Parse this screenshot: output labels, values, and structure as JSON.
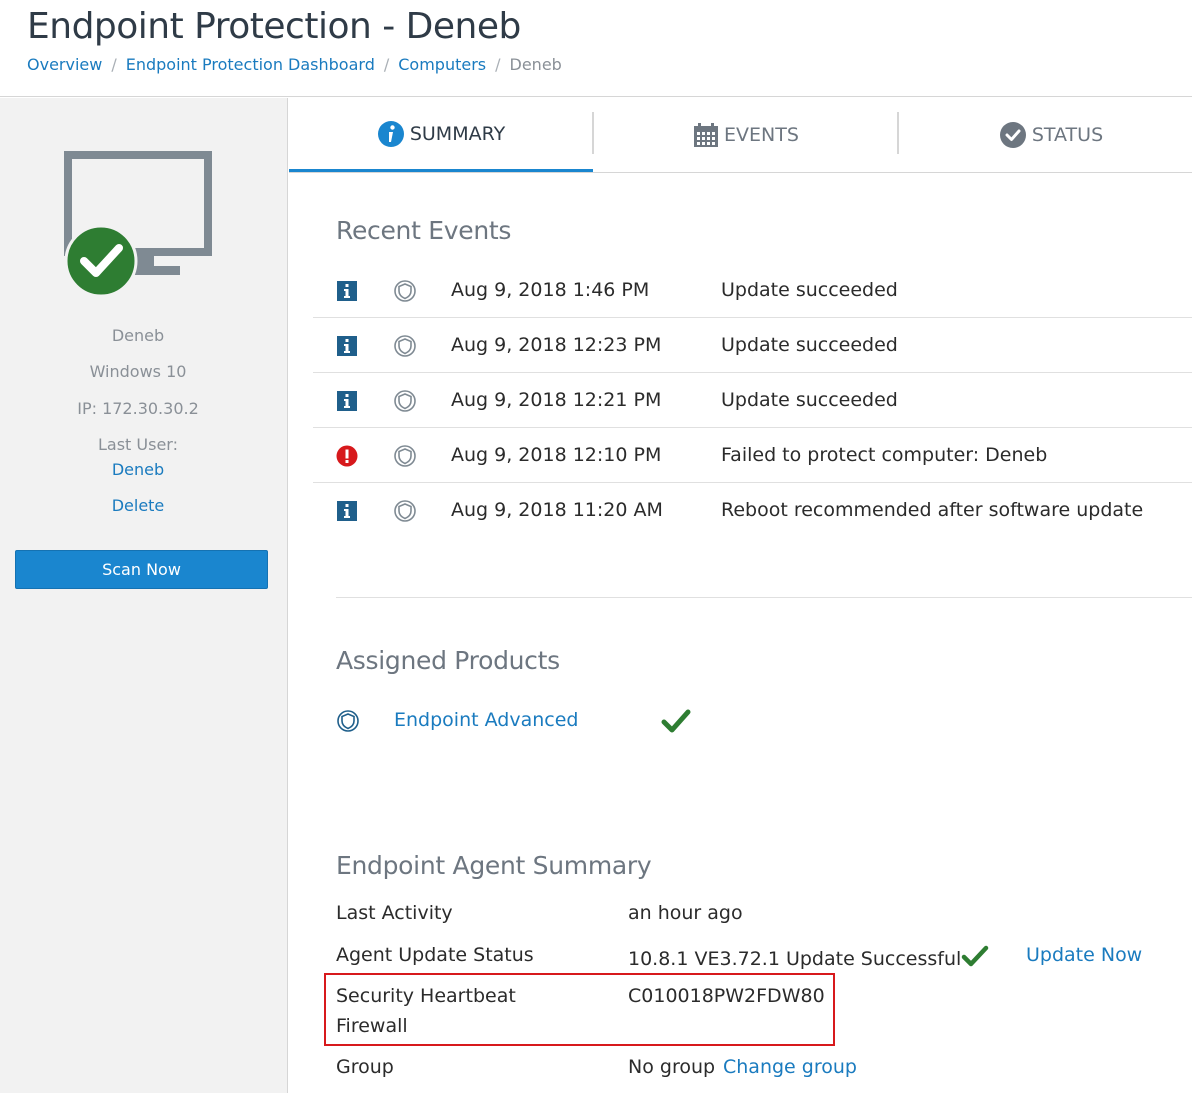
{
  "header": {
    "title": "Endpoint Protection - Deneb",
    "breadcrumb": [
      {
        "label": "Overview"
      },
      {
        "label": "Endpoint Protection Dashboard"
      },
      {
        "label": "Computers"
      },
      {
        "label": "Deneb"
      }
    ],
    "separator": "/"
  },
  "sidebar": {
    "device_icon": "monitor-icon",
    "status_icon": "check-circle-icon",
    "status_color": "#2e7d32",
    "computer_name": "Deneb",
    "os": "Windows 10",
    "ip": "IP: 172.30.30.2",
    "last_user_label": "Last User:",
    "last_user": "Deneb",
    "delete_label": "Delete",
    "scan_button": "Scan Now"
  },
  "tabs": [
    {
      "label": "SUMMARY",
      "icon": "info-circle-icon",
      "active": true
    },
    {
      "label": "EVENTS",
      "icon": "calendar-icon",
      "active": false
    },
    {
      "label": "STATUS",
      "icon": "check-circle-icon",
      "active": false
    }
  ],
  "recent_events": {
    "title": "Recent Events",
    "rows": [
      {
        "severity": "info",
        "icon": "info-icon",
        "product_icon": "shield-icon",
        "date": "Aug 9, 2018 1:46 PM",
        "description": "Update succeeded"
      },
      {
        "severity": "info",
        "icon": "info-icon",
        "product_icon": "shield-icon",
        "date": "Aug 9, 2018 12:23 PM",
        "description": "Update succeeded"
      },
      {
        "severity": "info",
        "icon": "info-icon",
        "product_icon": "shield-icon",
        "date": "Aug 9, 2018 12:21 PM",
        "description": "Update succeeded"
      },
      {
        "severity": "error",
        "icon": "error-icon",
        "product_icon": "shield-icon",
        "date": "Aug 9, 2018 12:10 PM",
        "description": "Failed to protect computer: Deneb"
      },
      {
        "severity": "info",
        "icon": "info-icon",
        "product_icon": "shield-icon",
        "date": "Aug 9, 2018 11:20 AM",
        "description": "Reboot recommended after software update"
      }
    ]
  },
  "assigned_products": {
    "title": "Assigned Products",
    "items": [
      {
        "name": "Endpoint Advanced",
        "icon": "shield-icon",
        "status_icon": "checkmark-icon"
      }
    ]
  },
  "agent_summary": {
    "title": "Endpoint Agent Summary",
    "last_activity_label": "Last Activity",
    "last_activity_value": "an hour ago",
    "update_status_label": "Agent Update Status",
    "update_status_value": "10.8.1 VE3.72.1 Update Successful",
    "update_now_label": "Update Now",
    "heartbeat_label_line1": "Security Heartbeat",
    "heartbeat_label_line2": "Firewall",
    "heartbeat_value": "C010018PW2FDW80",
    "group_label": "Group",
    "group_value": "No group",
    "change_group_label": "Change group"
  },
  "colors": {
    "accent": "#1a86cf",
    "link": "#1a7bbf",
    "success": "#2e7d32",
    "error": "#d7191c",
    "info": "#1f5f8b",
    "highlight": "#d7191c"
  }
}
